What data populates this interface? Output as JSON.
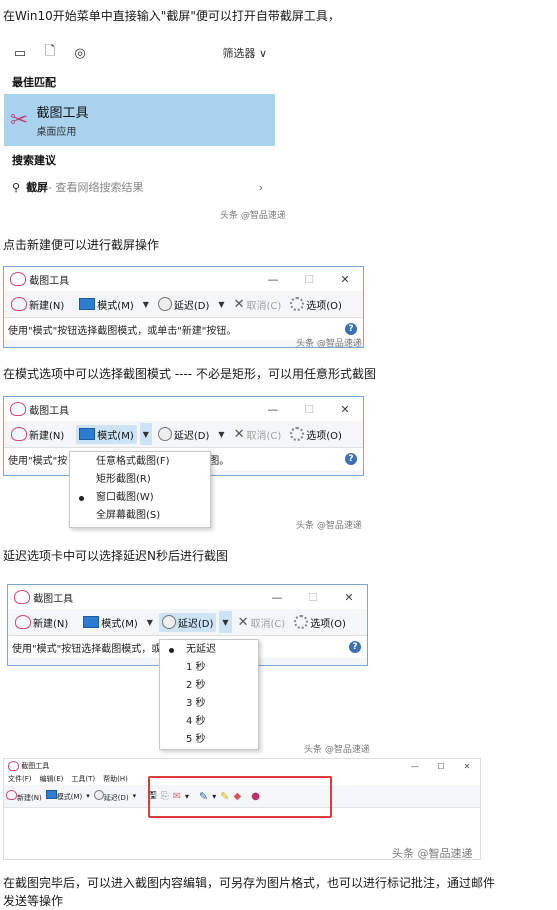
{
  "paragraphs": {
    "p1": "在Win10开始菜单中直接输入\"截屏\"便可以打开自带截屏工具，",
    "p2": "点击新建便可以进行截屏操作",
    "p3": "在模式选项中可以选择截图模式 ---- 不必是矩形，可以用任意形式截图",
    "p4": "延迟选项卡中可以选择延迟N秒后进行截图",
    "p5": "在截图完毕后，可以进入截图内容编辑，可另存为图片格式，也可以进行标记批注，通过邮件",
    "p6": "发送等操作"
  },
  "watermark": "头条 @智品速递",
  "start_menu": {
    "filter_label": "筛选器",
    "best_match_heading": "最佳匹配",
    "best_match_title": "截图工具",
    "best_match_subtitle": "桌面应用",
    "suggestions_heading": "搜索建议",
    "suggestion_query": "截屏",
    "suggestion_hint": " - 查看网络搜索结果"
  },
  "snip": {
    "title": "截图工具",
    "new": "新建(N)",
    "mode": "模式(M)",
    "delay": "延迟(D)",
    "cancel": "取消(C)",
    "options": "选项(O)",
    "status": "使用\"模式\"按钮选择截图模式，或单击\"新建\"按钮。",
    "status_short_a": "使用\"模式\"按",
    "status_short_a2": "图。",
    "status_short_b": "使用\"模式\"按钮选择截图模式，或",
    "help": "?",
    "min": "—",
    "max": "☐",
    "close": "✕"
  },
  "mode_menu": [
    "任意格式截图(F)",
    "矩形截图(R)",
    "窗口截图(W)",
    "全屏幕截图(S)"
  ],
  "mode_selected_index": 2,
  "delay_menu": [
    "无延迟",
    "1 秒",
    "2 秒",
    "3 秒",
    "4 秒",
    "5 秒"
  ],
  "delay_selected_index": 0,
  "editor": {
    "title": "截图工具",
    "menus": [
      "文件(F)",
      "编辑(E)",
      "工具(T)",
      "帮助(H)"
    ],
    "new": "新建(N)",
    "mode": "模式(M)",
    "delay": "延迟(D)"
  },
  "colors": {
    "highlight": "#a9d2ef",
    "accent_red": "#e03b3b"
  }
}
